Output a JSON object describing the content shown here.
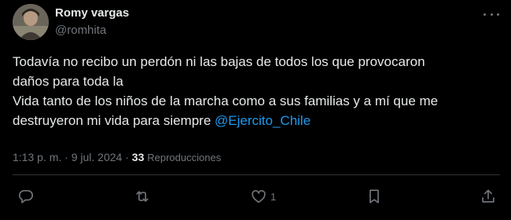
{
  "author": {
    "display_name": "Romy vargas",
    "handle": "@romhita"
  },
  "tweet": {
    "lines": [
      "Todavía no recibo un perdón ni las bajas de todos los que provocaron",
      "daños para toda la",
      "Vida tanto de los niños de la marcha como a sus familias y a mí que me"
    ],
    "last_line_text": "destruyeron mi vida para siempre ",
    "mention": "@Ejercito_Chile"
  },
  "meta": {
    "time": "1:13 p. m.",
    "separator": "·",
    "date": "9 jul. 2024",
    "views_count": "33",
    "views_label": "Reproducciones"
  },
  "actions": {
    "reply_icon": "reply-icon",
    "retweet_icon": "retweet-icon",
    "like_icon": "heart-icon",
    "like_count": "1",
    "bookmark_icon": "bookmark-icon",
    "share_icon": "share-icon"
  },
  "colors": {
    "background": "#000000",
    "text": "#e7e9ea",
    "secondary": "#71767b",
    "accent": "#1d9bf0",
    "divider": "#2f3336"
  }
}
